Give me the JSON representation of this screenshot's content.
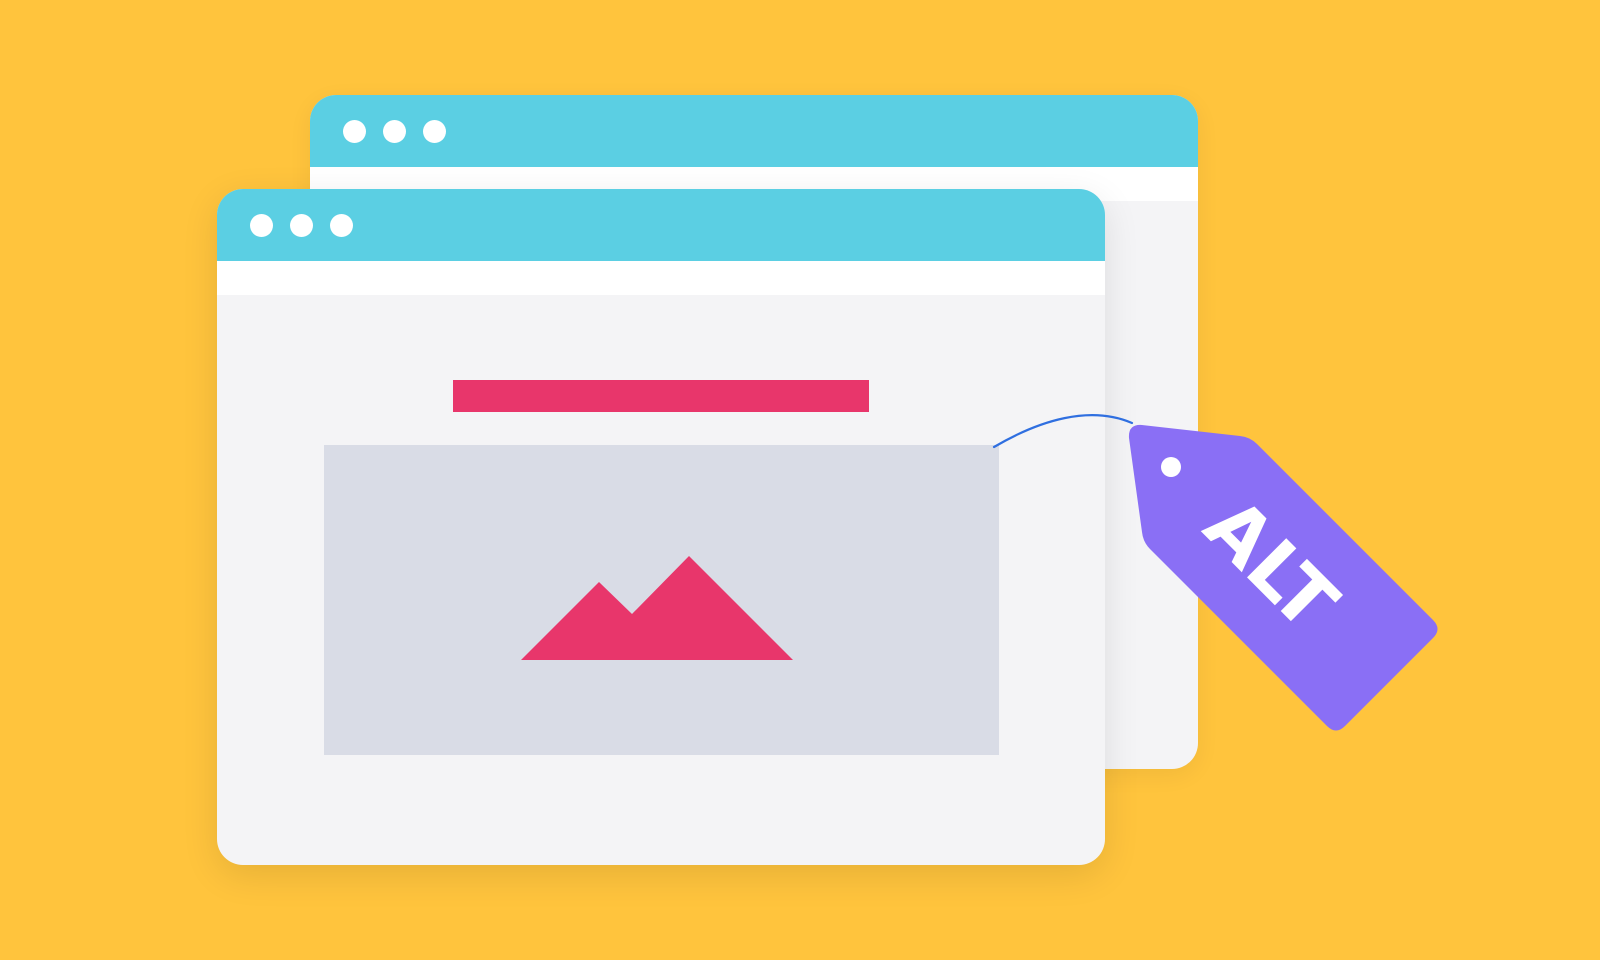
{
  "tag": {
    "label": "ALT"
  },
  "colors": {
    "background": "#ffc43d",
    "titlebar": "#5bcfe3",
    "window_body": "#f4f4f6",
    "address_bar": "#ffffff",
    "heading_bar": "#e8366b",
    "image_placeholder": "#d9dce6",
    "mountain": "#e8366b",
    "tag": "#8a6ff5",
    "string": "#2f6fe0"
  },
  "icons": {
    "image_icon": "mountain-image-icon",
    "tag_icon": "price-tag-icon"
  }
}
